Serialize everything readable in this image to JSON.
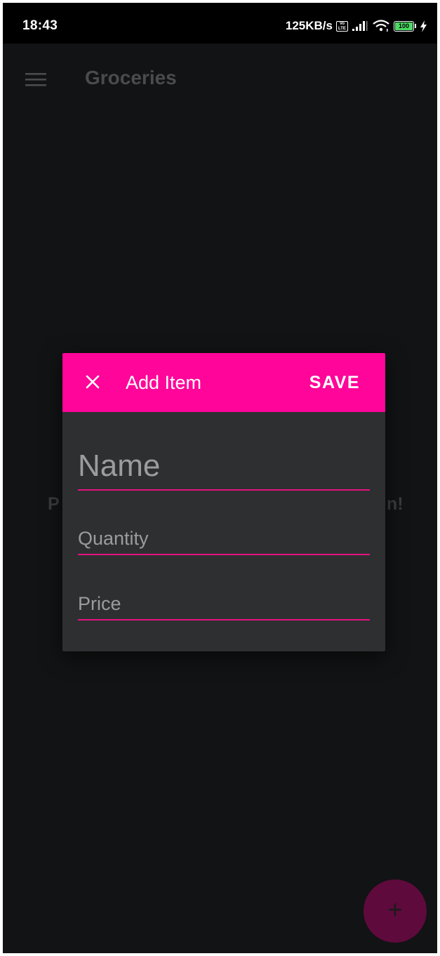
{
  "status_bar": {
    "time": "18:43",
    "net_speed": "125KB/s",
    "volte_label": "Vo LTE",
    "battery_level": "100",
    "icons": [
      "volte-icon",
      "signal-icon",
      "wifi-icon",
      "battery-icon",
      "charging-bolt-icon"
    ]
  },
  "app_bar": {
    "title": "Groceries",
    "menu_icon": "hamburger-menu-icon"
  },
  "background": {
    "empty_message_left": "P",
    "empty_message_right": "n!"
  },
  "dialog": {
    "title": "Add Item",
    "close_icon": "close-icon",
    "save_label": "SAVE",
    "fields": {
      "name": {
        "placeholder": "Name",
        "value": ""
      },
      "quantity": {
        "placeholder": "Quantity",
        "value": ""
      },
      "price": {
        "placeholder": "Price",
        "value": ""
      }
    }
  },
  "fab": {
    "icon": "plus-icon"
  },
  "colors": {
    "accent": "#ff0599",
    "field_underline": "#e4137f",
    "background": "#121314",
    "dialog_surface": "#2e2f31",
    "fab_dimmed": "#5e0a3c"
  }
}
